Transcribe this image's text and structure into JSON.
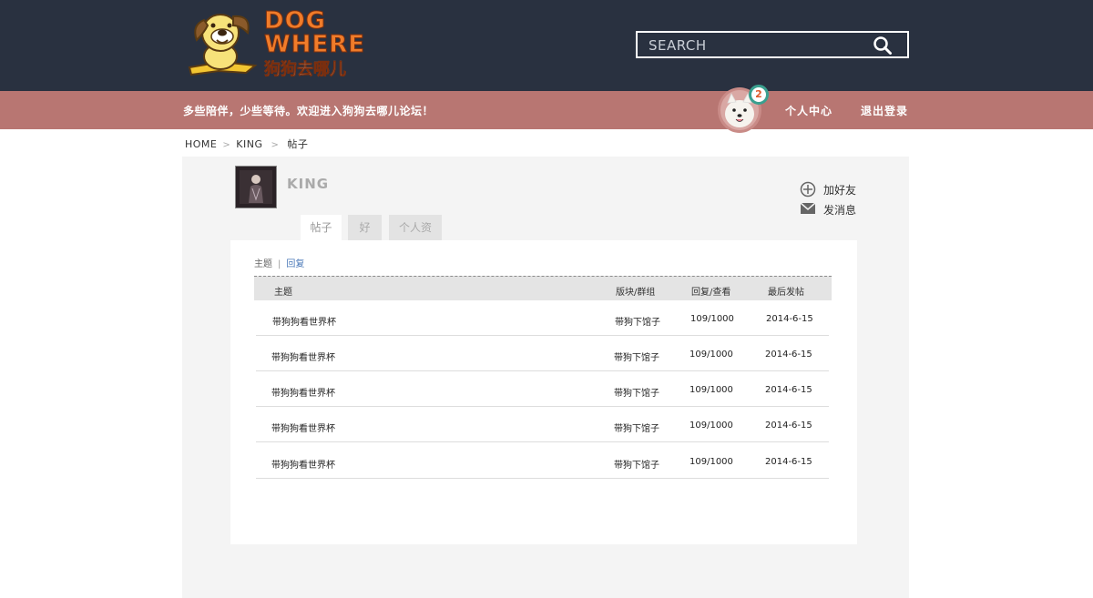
{
  "header": {
    "logo": {
      "word1": "DOG",
      "word2": "WHERE",
      "cn": "狗狗去哪儿"
    },
    "search": {
      "placeholder": "SEARCH"
    }
  },
  "welcome_bar": {
    "text": "多些陪伴，少些等待。欢迎进入狗狗去哪儿论坛！",
    "notification_count": "2",
    "links": {
      "profile": "个人中心",
      "logout": "退出登录"
    }
  },
  "breadcrumb": {
    "home": "HOME",
    "user": "KING",
    "current": "帖子"
  },
  "profile": {
    "username": "KING",
    "actions": {
      "add_friend": "加好友",
      "message": "发消息"
    },
    "tabs": [
      "帖子",
      "好友",
      "个人资料"
    ]
  },
  "posts": {
    "subtabs": {
      "topic": "主题",
      "reply": "回复"
    },
    "columns": [
      "主题",
      "版块/群组",
      "回复/查看",
      "最后发帖"
    ],
    "rows": [
      {
        "title": "带狗狗看世界杯",
        "board": "带狗下馆子",
        "stats": "109/1000",
        "date": "2014-6-15"
      },
      {
        "title": "带狗狗看世界杯",
        "board": "带狗下馆子",
        "stats": "109/1000",
        "date": "2014-6-15"
      },
      {
        "title": "带狗狗看世界杯",
        "board": "带狗下馆子",
        "stats": "109/1000",
        "date": "2014-6-15"
      },
      {
        "title": "带狗狗看世界杯",
        "board": "带狗下馆子",
        "stats": "109/1000",
        "date": "2014-6-15"
      },
      {
        "title": "带狗狗看世界杯",
        "board": "带狗下馆子",
        "stats": "109/1000",
        "date": "2014-6-15"
      }
    ]
  },
  "colors": {
    "header_bg": "#293140",
    "welcome_bg": "#b87672",
    "link_blue": "#4a78b8",
    "logo_orange": "#f07c2a"
  }
}
